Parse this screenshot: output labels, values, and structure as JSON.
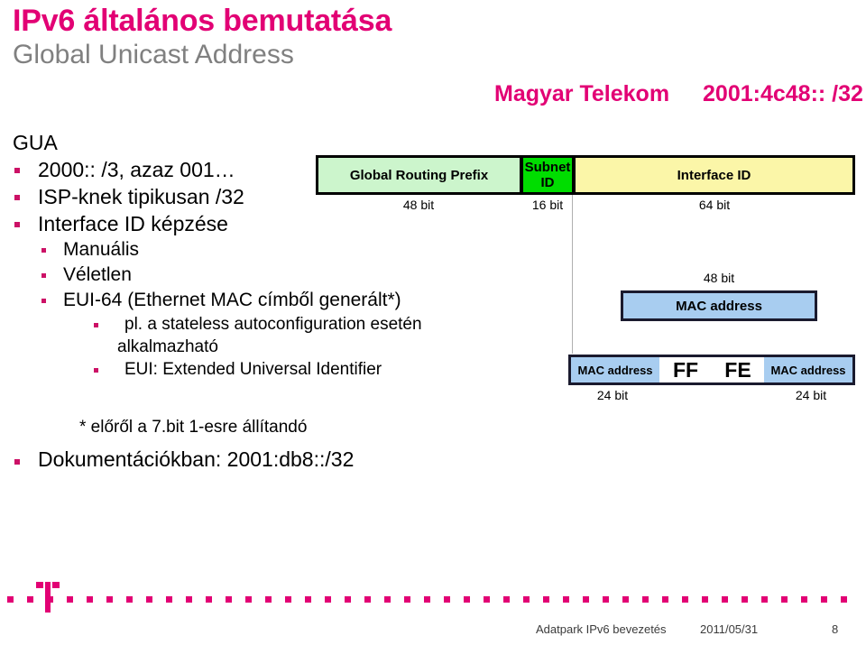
{
  "slide": {
    "title": "IPv6 általános bemutatása",
    "subtitle": "Global Unicast Address",
    "operator": {
      "name": "Magyar Telekom",
      "prefix": "2001:4c48:: /32"
    },
    "lead": "GUA",
    "bullets": [
      {
        "level": 1,
        "text": "2000:: /3, azaz  001…"
      },
      {
        "level": 1,
        "text": "ISP-knek tipikusan  /32"
      },
      {
        "level": 1,
        "text": "Interface ID képzése"
      },
      {
        "level": 2,
        "text": "Manuális"
      },
      {
        "level": 2,
        "text": "Véletlen"
      },
      {
        "level": 2,
        "text": "EUI-64 (Ethernet MAC címből generált*)"
      },
      {
        "level": 3,
        "text": "pl. a stateless autoconfiguration esetén",
        "text2": "alkalmazható"
      },
      {
        "level": 3,
        "text": "EUI: Extended Universal Identifier"
      }
    ],
    "footnote": "* előről a 7.bit 1-esre állítandó",
    "doc_line": "Dokumentációkban:  2001:db8::/32"
  },
  "address_diagram": {
    "segments": [
      {
        "label": "Global Routing Prefix",
        "bits": "48 bit",
        "color": "#ccf5cc"
      },
      {
        "label": "Subnet\nID",
        "label_line1": "Subnet",
        "label_line2": "ID",
        "bits": "16 bit",
        "color": "#00dd00"
      },
      {
        "label": "Interface ID",
        "bits": "64 bit",
        "color": "#fbf6a8"
      }
    ]
  },
  "mac_diagram": {
    "mac48_bits": "48 bit",
    "mac48_label": "MAC address",
    "eui": {
      "left_label": "MAC address",
      "ff": "FF",
      "fe": "FE",
      "right_label": "MAC address",
      "left_bits": "24 bit",
      "right_bits": "24 bit"
    }
  },
  "footer": {
    "left": "Adatpark IPv6 bevezetés",
    "date": "2011/05/31",
    "page": "8"
  },
  "colors": {
    "brand_magenta": "#e20074",
    "subtitle_gray": "#808080",
    "prefix_green": "#ccf5cc",
    "subnet_green": "#00dd00",
    "interface_yellow": "#fbf6a8",
    "mac_blue": "#a8cdf0"
  }
}
